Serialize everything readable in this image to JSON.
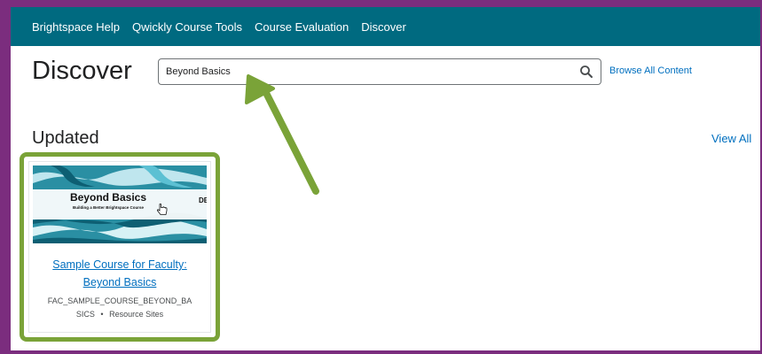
{
  "nav": {
    "items": [
      "Brightspace Help",
      "Qwickly Course Tools",
      "Course Evaluation",
      "Discover"
    ]
  },
  "page": {
    "title": "Discover"
  },
  "search": {
    "value": "Beyond Basics",
    "browse_label": "Browse All Content"
  },
  "updated": {
    "title": "Updated",
    "view_all_label": "View All",
    "card": {
      "image_title": "Beyond Basics",
      "image_subtitle": "Building a Better Brightspace Course",
      "image_tag": "DE",
      "title_line1": "Sample Course for Faculty:",
      "title_line2": "Beyond Basics",
      "code_line1": "FAC_SAMPLE_COURSE_BEYOND_BA",
      "code_line2": "SICS",
      "separator": "•",
      "category": "Resource Sites"
    }
  },
  "colors": {
    "navbar": "#006a80",
    "outer_frame": "#7b2d7e",
    "highlight": "#7aa338",
    "link": "#006fbf"
  },
  "icons": {
    "search": "search-icon",
    "cursor": "hand-cursor-icon",
    "annotation": "green-arrow-icon"
  }
}
